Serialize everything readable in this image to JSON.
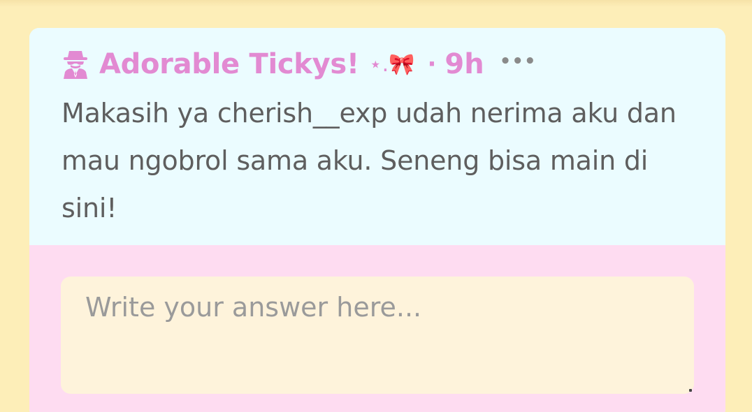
{
  "post": {
    "sender_name": "Adorable Tickys!",
    "sender_decoration": "⋆.🎀",
    "separator": "·",
    "time": "9h",
    "more_label": "•••",
    "message": "Makasih ya cherish__exp udah nerima aku dan mau ngobrol sama aku. Seneng bisa main di sini!"
  },
  "answer": {
    "placeholder": "Write your answer here...",
    "value": ""
  },
  "icons": {
    "sender_avatar": "spy-icon",
    "more": "more-options-icon",
    "resize": "resize-grip-icon"
  },
  "colors": {
    "page_background": "#fdeeb8",
    "message_background": "#ebfcff",
    "answer_background": "#fedcf1",
    "input_background": "#fef3db",
    "accent_pink": "#e28ad2",
    "body_text": "#5e5e5e",
    "placeholder_text": "#9a9a9a"
  }
}
